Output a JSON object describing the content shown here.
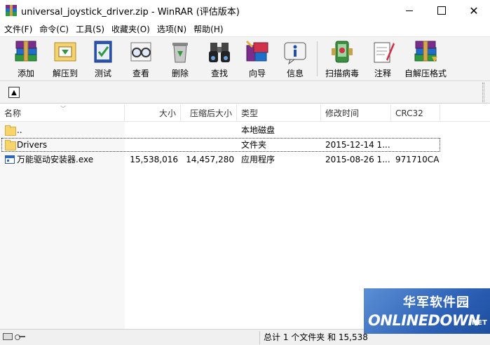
{
  "window": {
    "title": "universal_joystick_driver.zip - WinRAR (评估版本)",
    "close_glyph": "✕"
  },
  "menu": [
    "文件(F)",
    "命令(C)",
    "工具(S)",
    "收藏夹(O)",
    "选项(N)",
    "帮助(H)"
  ],
  "toolbar": {
    "buttons": [
      {
        "label": "添加",
        "icon": "add-books-icon"
      },
      {
        "label": "解压到",
        "icon": "extract-folder-icon"
      },
      {
        "label": "测试",
        "icon": "test-book-icon"
      },
      {
        "label": "查看",
        "icon": "view-glasses-icon"
      },
      {
        "label": "删除",
        "icon": "delete-recycle-icon"
      },
      {
        "label": "查找",
        "icon": "find-binoculars-icon"
      },
      {
        "label": "向导",
        "icon": "wizard-icon"
      },
      {
        "label": "信息",
        "icon": "info-icon"
      },
      {
        "label": "扫描病毒",
        "icon": "virus-scan-icon"
      },
      {
        "label": "注释",
        "icon": "comment-icon"
      },
      {
        "label": "自解压格式",
        "icon": "sfx-icon"
      }
    ]
  },
  "address": {
    "up_glyph": "▲"
  },
  "list": {
    "columns": [
      "名称",
      "大小",
      "压缩后大小",
      "类型",
      "修改时间",
      "CRC32"
    ],
    "rows": [
      {
        "name": "..",
        "size": "",
        "packed": "",
        "type": "本地磁盘",
        "modified": "",
        "crc": "",
        "icon": "folder-up"
      },
      {
        "name": "Drivers",
        "size": "",
        "packed": "",
        "type": "文件夹",
        "modified": "2015-12-14 1...",
        "crc": "",
        "icon": "folder"
      },
      {
        "name": "万能驱动安装器.exe",
        "size": "15,538,016",
        "packed": "14,457,280",
        "type": "应用程序",
        "modified": "2015-08-26 1...",
        "crc": "971710CA",
        "icon": "exe"
      }
    ]
  },
  "status": {
    "text": "总计 1 个文件夹 和 15,538"
  },
  "watermark": {
    "cn": "华军软件园",
    "en": "ONLINEDOWN",
    "net": ".NET"
  },
  "colors": {
    "folder": "#f8d56b",
    "watermark_bg": "#2d62b8",
    "toolbar_bg": "#f3f3f3"
  }
}
